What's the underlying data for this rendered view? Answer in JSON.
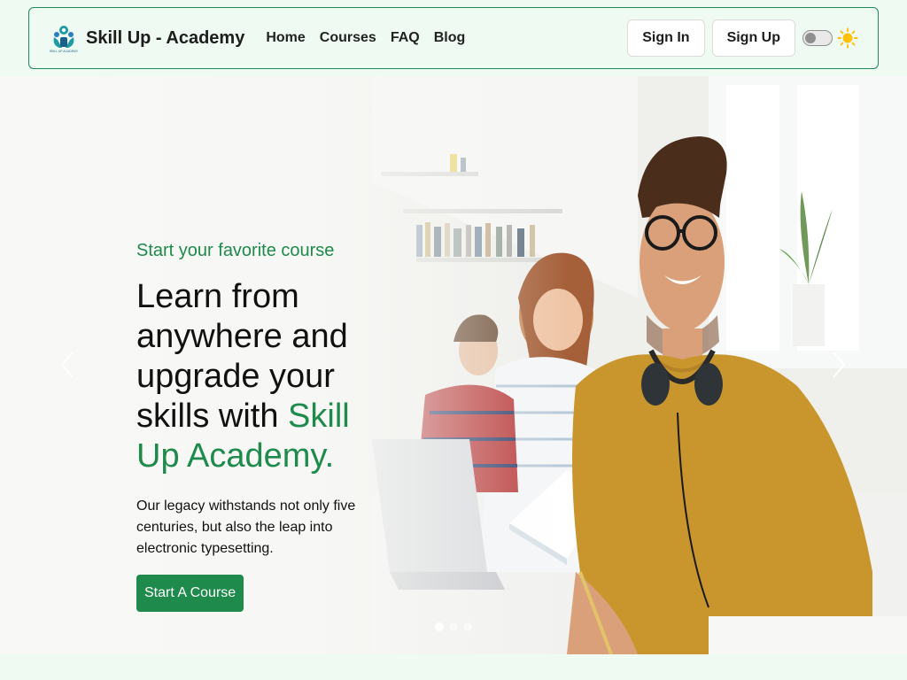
{
  "navbar": {
    "brand_name": "Skill Up - Academy",
    "brand_logo_text": "SKILL UP ACADEMY",
    "links": [
      "Home",
      "Courses",
      "FAQ",
      "Blog"
    ],
    "sign_in": "Sign In",
    "sign_up": "Sign Up",
    "theme_toggle": "off",
    "theme_icon": "sun-icon"
  },
  "hero": {
    "eyebrow": "Start your favorite course",
    "title_plain": "Learn from anywhere and upgrade your skills with",
    "title_accent": "Skill Up Academy.",
    "text": "Our legacy withstands not only five centuries, but also the leap into electronic typesetting.",
    "cta": "Start A Course",
    "slides_total": 3,
    "active_slide": 1
  },
  "colors": {
    "accent": "#1e8a4c",
    "page_bg": "#eefaf2",
    "border": "#1e8a5a"
  },
  "icons": {
    "prev": "chevron-left-icon",
    "next": "chevron-right-icon"
  }
}
